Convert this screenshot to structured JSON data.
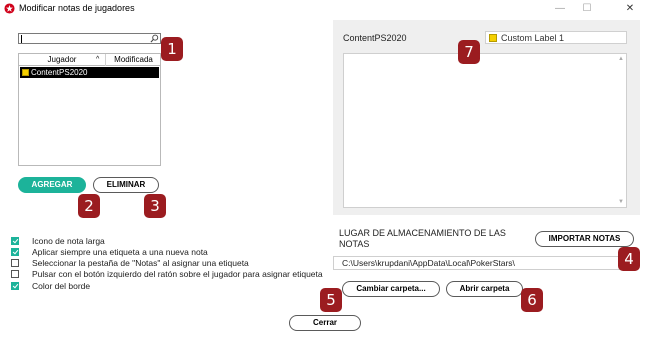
{
  "window": {
    "title": "Modificar notas de jugadores",
    "controls": {
      "minimize": "—",
      "maximize": "☐",
      "close": "✕"
    }
  },
  "search": {
    "value": "",
    "placeholder": ""
  },
  "table": {
    "headers": [
      "Jugador",
      "Modificada"
    ],
    "sort_indicator": "^",
    "rows": [
      {
        "name": "ContentPS2020",
        "modified": "",
        "label_color": "#f5d000",
        "selected": true
      }
    ]
  },
  "buttons": {
    "add": "AGREGAR",
    "delete": "ELIMINAR",
    "import_notes": "IMPORTAR NOTAS",
    "change_folder": "Cambiar carpeta...",
    "open_folder": "Abrir carpeta",
    "close": "Cerrar"
  },
  "options": [
    {
      "label": "Icono de nota larga",
      "checked": true
    },
    {
      "label": "Aplicar siempre una etiqueta a una nueva nota",
      "checked": true
    },
    {
      "label": "Seleccionar la pestaña de \"Notas\" al asignar una etiqueta",
      "checked": false
    },
    {
      "label": "Pulsar con el botón izquierdo del ratón sobre el jugador para asignar etiqueta",
      "checked": false
    },
    {
      "label": "Color del borde",
      "checked": true
    }
  ],
  "notes": {
    "player": "ContentPS2020",
    "label": {
      "text": "Custom Label 1",
      "color": "#f5d000"
    },
    "text": ""
  },
  "storage": {
    "title": "LUGAR DE ALMACENAMIENTO DE LAS NOTAS",
    "path": "C:\\Users\\krupdani\\AppData\\Local\\PokerStars\\"
  },
  "callouts": [
    "1",
    "2",
    "3",
    "4",
    "5",
    "6",
    "7"
  ],
  "colors": {
    "accent": "#1cb39a",
    "callout": "#9b1c20",
    "selection": "#000000"
  }
}
